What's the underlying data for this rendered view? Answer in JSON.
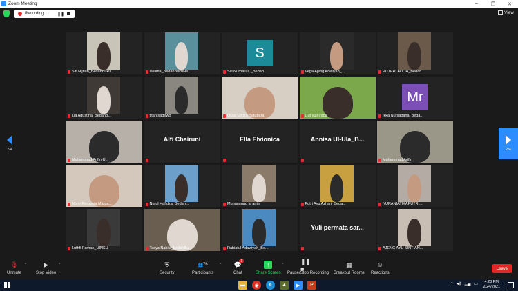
{
  "window": {
    "title": "Zoom Meeting",
    "minimize": "–",
    "restore": "❐",
    "close": "✕"
  },
  "recording": {
    "label": "Recording..."
  },
  "view": {
    "label": "View"
  },
  "pager": {
    "left": "2/4",
    "right": "2/4"
  },
  "participants": [
    {
      "name": "Siti Hijriah_BedahBuku...",
      "kind": "video"
    },
    {
      "name": "Delima_BedahBukuHe...",
      "kind": "video"
    },
    {
      "name": "Siti Nurhaliza _Bedah...",
      "kind": "avatar",
      "initials": "S",
      "color": "#1d8a99"
    },
    {
      "name": "Vega Ajeng Adeliyah_...",
      "kind": "video"
    },
    {
      "name": "PUTERI AULIA_Bedah...",
      "kind": "video"
    },
    {
      "name": "Lia Agustina_BedahB...",
      "kind": "video"
    },
    {
      "name": "titan sadewo",
      "kind": "video"
    },
    {
      "name": "Oksa Elfriza Batubara",
      "kind": "video"
    },
    {
      "name": "Cut yuli Irada",
      "kind": "video"
    },
    {
      "name": "Ikka Nursabana_Beda...",
      "kind": "avatar",
      "initials": "Mr",
      "color": "#7b4fb5"
    },
    {
      "name": "Muhammad Arifin-U...",
      "kind": "video"
    },
    {
      "name": "Alfi Chairuni",
      "kind": "text"
    },
    {
      "name": "Ella Elvionica",
      "kind": "text"
    },
    {
      "name": "Annisa  Ul-Ula_B...",
      "kind": "text"
    },
    {
      "name": "Muhammad Arifin",
      "kind": "video"
    },
    {
      "name": "Nomi Renamia Marpa...",
      "kind": "video"
    },
    {
      "name": "Nurul Hafidza_Bedah...",
      "kind": "video"
    },
    {
      "name": "Muhammad al arrin",
      "kind": "video"
    },
    {
      "name": "Putri Ayu Azhari_Beda...",
      "kind": "video"
    },
    {
      "name": "NURANIATIKAPUTRI...",
      "kind": "video"
    },
    {
      "name": "Luthfi Farhan_UINSU",
      "kind": "video"
    },
    {
      "name": "Tasya Nabila_bedahBu...",
      "kind": "video"
    },
    {
      "name": "Rabiatul Adawiyah_Be...",
      "kind": "video"
    },
    {
      "name": "Yuli permata sar...",
      "kind": "text"
    },
    {
      "name": "AJENG AYU SINTIAN...",
      "kind": "video"
    }
  ],
  "toolbar": {
    "unmute": "Unmute",
    "stop_video": "Stop Video",
    "security": "Security",
    "participants": "Participants",
    "participants_count": "76",
    "chat": "Chat",
    "chat_badge": "1",
    "share_screen": "Share Screen",
    "record": "Pause/Stop Recording",
    "breakout": "Breakout Rooms",
    "reactions": "Reactions",
    "leave": "Leave"
  },
  "taskbar": {
    "time": "4:28 PM",
    "date": "2/24/2021"
  }
}
